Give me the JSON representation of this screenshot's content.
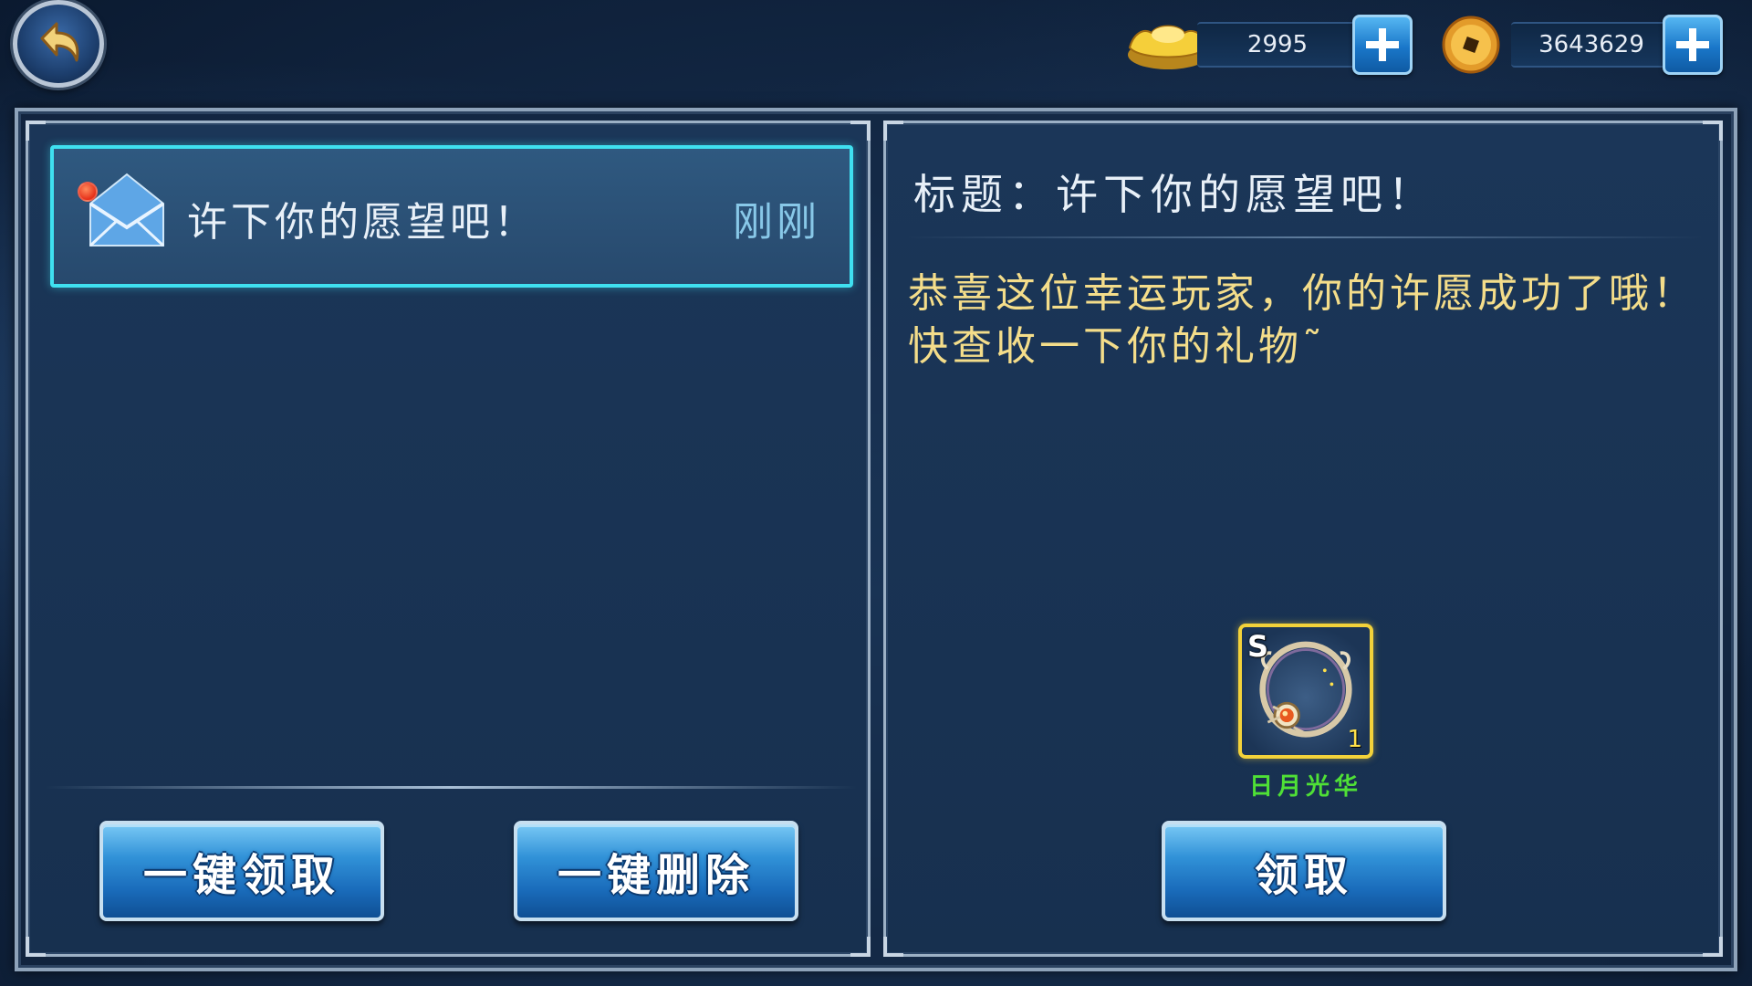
{
  "header": {
    "back_icon": "back-arrow-icon",
    "gold_ingot": {
      "icon": "gold-ingot-icon",
      "amount": "2995"
    },
    "copper_coin": {
      "icon": "copper-coin-icon",
      "amount": "3643629"
    },
    "plus_icon": "plus-icon"
  },
  "mail_list": {
    "items": [
      {
        "subject": "许下你的愿望吧！",
        "time": "刚刚",
        "unread": true,
        "icon": "envelope-icon"
      }
    ],
    "claim_all_label": "一键领取",
    "delete_all_label": "一键删除"
  },
  "mail_detail": {
    "title": "标题：许下你的愿望吧！",
    "body_line1": "恭喜这位幸运玩家，你的许愿成功了哦！",
    "body_line2": "快查收一下你的礼物˜",
    "reward": {
      "grade": "S",
      "count": "1",
      "name": "日月光华"
    },
    "claim_label": "领取"
  },
  "colors": {
    "accent_cyan": "#3fe0f0",
    "body_text": "#f4dd8a",
    "reward_name": "#4fe036",
    "reward_border": "#f3d23a"
  }
}
